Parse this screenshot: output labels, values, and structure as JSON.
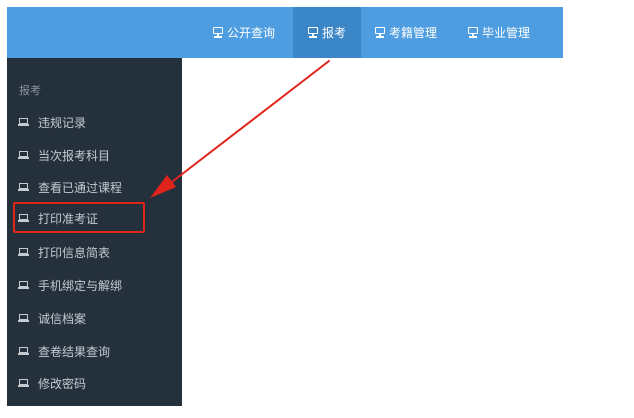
{
  "topnav": {
    "items": [
      {
        "label": "公开查询",
        "icon": "monitor-icon"
      },
      {
        "label": "报考",
        "icon": "monitor-icon",
        "active": true
      },
      {
        "label": "考籍管理",
        "icon": "monitor-icon"
      },
      {
        "label": "毕业管理",
        "icon": "monitor-icon"
      }
    ]
  },
  "sidebar": {
    "section_title": "报考",
    "items": [
      {
        "label": "违规记录",
        "icon": "laptop-icon"
      },
      {
        "label": "当次报考科目",
        "icon": "laptop-icon"
      },
      {
        "label": "查看已通过课程",
        "icon": "laptop-icon"
      },
      {
        "label": "打印准考证",
        "icon": "laptop-icon",
        "highlighted": true
      },
      {
        "label": "打印信息简表",
        "icon": "laptop-icon"
      },
      {
        "label": "手机绑定与解绑",
        "icon": "laptop-icon"
      },
      {
        "label": "诚信档案",
        "icon": "laptop-icon"
      },
      {
        "label": "查卷结果查询",
        "icon": "laptop-icon"
      },
      {
        "label": "修改密码",
        "icon": "laptop-icon"
      }
    ]
  },
  "colors": {
    "topbar": "#4d9de0",
    "topbar_active": "#3b86c7",
    "sidebar": "#24303c",
    "annotation": "#e0241b"
  }
}
